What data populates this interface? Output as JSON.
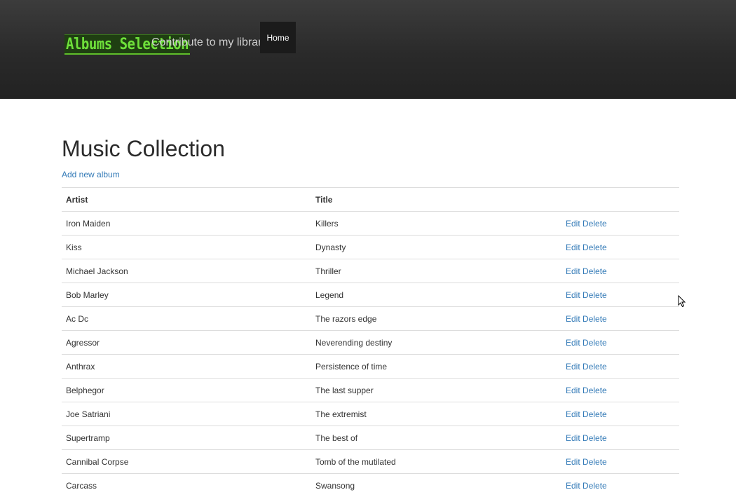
{
  "header": {
    "logo_text": "Albums Selection",
    "tagline": "Contribute to my library",
    "nav": [
      {
        "label": "Home"
      }
    ]
  },
  "main": {
    "title": "Music Collection",
    "add_link": "Add new album",
    "table": {
      "columns": [
        "Artist",
        "Title",
        ""
      ],
      "action_labels": {
        "edit": "Edit",
        "delete": "Delete"
      },
      "rows": [
        {
          "artist": "Iron Maiden",
          "title": "Killers"
        },
        {
          "artist": "Kiss",
          "title": "Dynasty"
        },
        {
          "artist": "Michael Jackson",
          "title": "Thriller"
        },
        {
          "artist": "Bob Marley",
          "title": "Legend"
        },
        {
          "artist": "Ac Dc",
          "title": "The razors edge"
        },
        {
          "artist": "Agressor",
          "title": "Neverending destiny"
        },
        {
          "artist": "Anthrax",
          "title": "Persistence of time"
        },
        {
          "artist": "Belphegor",
          "title": "The last supper"
        },
        {
          "artist": "Joe Satriani",
          "title": "The extremist"
        },
        {
          "artist": "Supertramp",
          "title": "The best of"
        },
        {
          "artist": "Cannibal Corpse",
          "title": "Tomb of the mutilated"
        },
        {
          "artist": "Carcass",
          "title": "Swansong"
        }
      ]
    }
  },
  "colors": {
    "link": "#337ab7",
    "navbar": "#2a2a2a",
    "logo_green": "#6ee03a"
  }
}
